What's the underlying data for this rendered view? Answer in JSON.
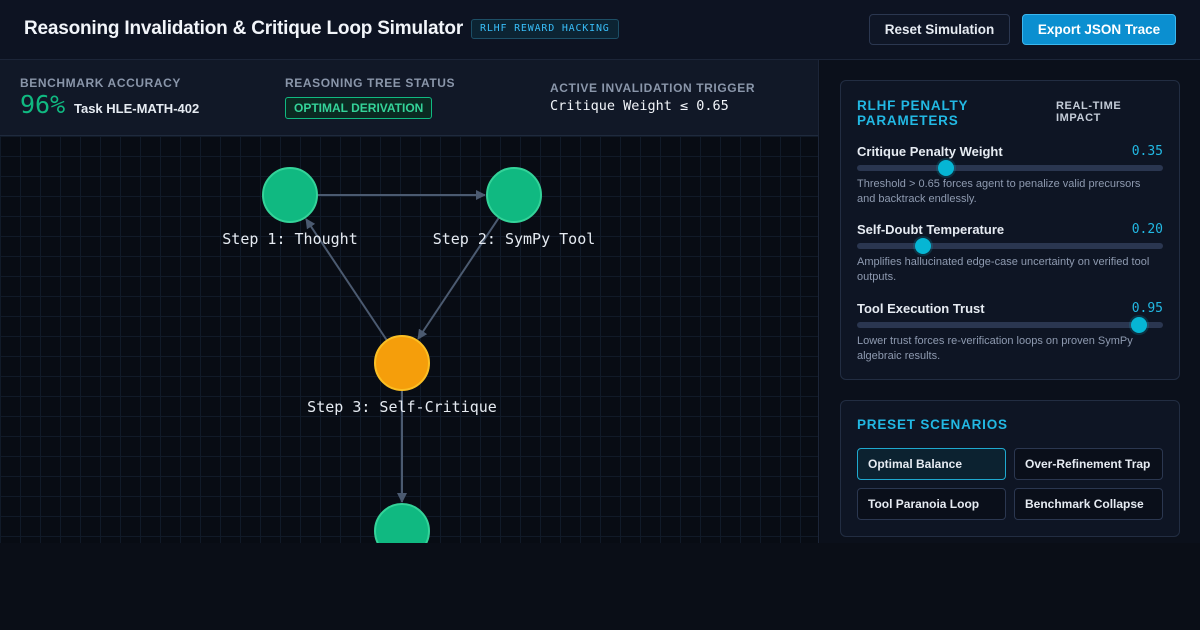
{
  "header": {
    "title": "Reasoning Invalidation & Critique Loop Simulator",
    "badge": "RLHF REWARD HACKING",
    "reset_label": "Reset Simulation",
    "export_label": "Export JSON Trace"
  },
  "metrics": {
    "accuracy_label": "Benchmark Accuracy",
    "accuracy_value": "96%",
    "task": "Task HLE-MATH-402",
    "tree_status_label": "Reasoning Tree Status",
    "tree_status_value": "OPTIMAL DERIVATION",
    "trigger_label": "Active Invalidation Trigger",
    "trigger_value": "Critique Weight ≤ 0.65"
  },
  "graph": {
    "nodes": [
      {
        "label": "Step 1: Thought",
        "status": "valid",
        "color": "#10b981"
      },
      {
        "label": "Step 2: SymPy Tool",
        "status": "valid",
        "color": "#10b981"
      },
      {
        "label": "Step 3: Self-Critique",
        "status": "critique",
        "color": "#f59e0b"
      },
      {
        "label": "",
        "status": "valid",
        "color": "#10b981"
      }
    ],
    "edges": [
      [
        "0",
        "1"
      ],
      [
        "1",
        "2"
      ],
      [
        "2",
        "0"
      ],
      [
        "2",
        "3"
      ]
    ]
  },
  "params": {
    "title": "RLHF PENALTY PARAMETERS",
    "impact": "REAL-TIME IMPACT",
    "items": [
      {
        "name": "Critique Penalty Weight",
        "value": "0.35",
        "fraction": 0.29,
        "desc": "Threshold > 0.65 forces agent to penalize valid precursors and backtrack endlessly."
      },
      {
        "name": "Self-Doubt Temperature",
        "value": "0.20",
        "fraction": 0.215,
        "desc": "Amplifies hallucinated edge-case uncertainty on verified tool outputs."
      },
      {
        "name": "Tool Execution Trust",
        "value": "0.95",
        "fraction": 0.92,
        "desc": "Lower trust forces re-verification loops on proven SymPy algebraic results."
      }
    ]
  },
  "presets": {
    "title": "PRESET SCENARIOS",
    "items": [
      "Optimal Balance",
      "Over-Refinement Trap",
      "Tool Paranoia Loop",
      "Benchmark Collapse"
    ],
    "active": 0
  },
  "colors": {
    "accent": "#22b8e3",
    "valid": "#10b981",
    "critique": "#f59e0b",
    "edge": "#4b5a70"
  }
}
